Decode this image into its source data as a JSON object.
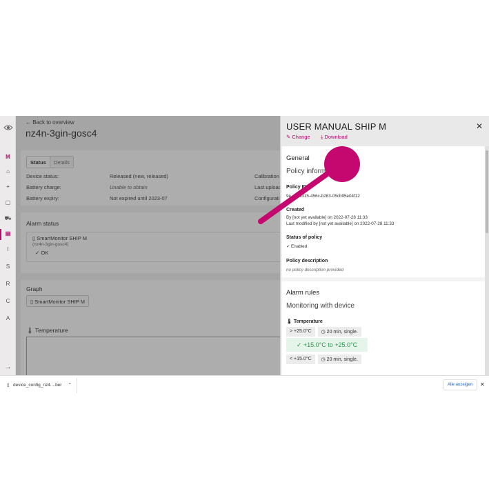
{
  "rail": {
    "items": [
      "M",
      "S",
      "R",
      "C",
      "A"
    ]
  },
  "main": {
    "back_label": "Back to overview",
    "device_title": "nz4n-3gin-gosc4",
    "tabs": [
      "Status",
      "Details"
    ],
    "status_rows": [
      {
        "label": "Device status:",
        "value": "Released (new, released)"
      },
      {
        "label": "Battery charge:",
        "value": "Unable to obtain"
      },
      {
        "label": "Battery expiry:",
        "value": "Not expired until 2023-07"
      }
    ],
    "right_labels": [
      "Calibration",
      "Last upload",
      "Configurati"
    ],
    "alarm_status": {
      "heading": "Alarm status",
      "device_name": "SmartMonitor SHIP M",
      "device_sub": "(nz4n-3gin-gosc4)",
      "state": "OK"
    },
    "graph": {
      "heading": "Graph",
      "chip": "SmartMonitor SHIP M",
      "temperature_label": "Temperature"
    }
  },
  "panel": {
    "title": "USER MANUAL SHIP M",
    "change_label": "Change",
    "download_label": "Download",
    "general": {
      "heading": "General",
      "subheading": "Policy informa",
      "policy_id_label": "Policy ID",
      "policy_id_value": "9e…1-4315-456c-b283-05cb95e04f12",
      "created_label": "Created",
      "created_by": "By [not yet available] on 2022-07-28 11:33",
      "modified_by": "Last modified by [not yet available] on 2022-07-28 11:33",
      "status_label": "Status of policy",
      "status_value": "Enabled",
      "desc_label": "Policy description",
      "desc_value": "no policy description provided"
    },
    "alarm_rules": {
      "heading": "Alarm rules",
      "subheading": "Monitoring with device",
      "temp_label": "Temperature",
      "rule_high_cond": "> +25.0°C",
      "rule_high_time": "20 min, single.",
      "range": "+15.0°C to +25.0°C",
      "rule_low_cond": "< +15.0°C",
      "rule_low_time": "20 min, single."
    }
  },
  "download_bar": {
    "file_name": "device_config_nz4....ber",
    "show_all": "Alle anzeigen"
  },
  "colors": {
    "accent": "#b40a6d",
    "ok_green": "#2c9a4e",
    "link_blue": "#1a5fd0"
  }
}
